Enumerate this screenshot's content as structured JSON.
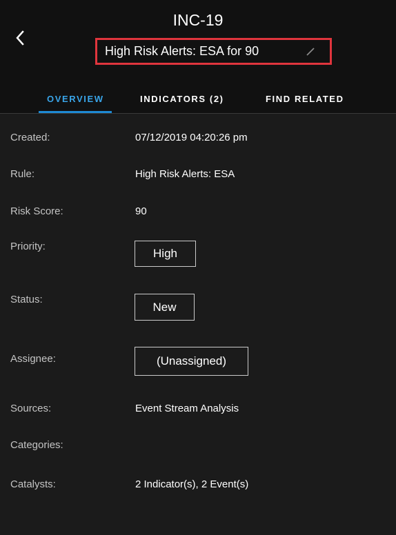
{
  "header": {
    "incident_id": "INC-19",
    "title": "High Risk Alerts: ESA for 90",
    "back_icon": "chevron-left-icon",
    "edit_icon": "pencil-icon"
  },
  "tabs": [
    {
      "label": "OVERVIEW",
      "active": true
    },
    {
      "label": "INDICATORS (2)",
      "active": false
    },
    {
      "label": "FIND RELATED",
      "active": false
    }
  ],
  "overview": {
    "created": {
      "label": "Created:",
      "value": "07/12/2019 04:20:26 pm"
    },
    "rule": {
      "label": "Rule:",
      "value": "High Risk Alerts: ESA"
    },
    "risk_score": {
      "label": "Risk Score:",
      "value": "90"
    },
    "priority": {
      "label": "Priority:",
      "value": "High"
    },
    "status": {
      "label": "Status:",
      "value": "New"
    },
    "assignee": {
      "label": "Assignee:",
      "value": "(Unassigned)"
    },
    "sources": {
      "label": "Sources:",
      "value": "Event Stream Analysis"
    },
    "categories": {
      "label": "Categories:",
      "value": ""
    },
    "catalysts": {
      "label": "Catalysts:",
      "value": "2 Indicator(s), 2 Event(s)"
    }
  },
  "colors": {
    "background": "#1b1b1b",
    "header_background": "#111111",
    "active_tab": "#39a4e8",
    "highlight_border": "#e0353d"
  }
}
